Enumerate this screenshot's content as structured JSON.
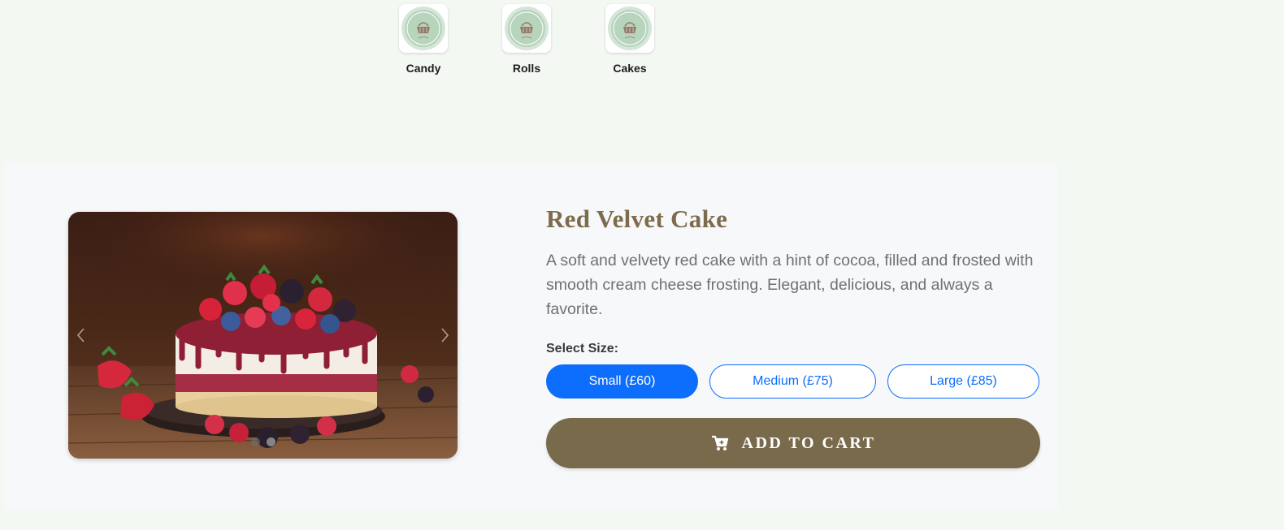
{
  "categories": [
    {
      "label": "Candy",
      "icon": "basket-icon"
    },
    {
      "label": "Rolls",
      "icon": "basket-icon"
    },
    {
      "label": "Cakes",
      "icon": "basket-icon"
    }
  ],
  "product": {
    "title": "Red Velvet Cake",
    "description": "A soft and velvety red cake with a hint of cocoa, filled and frosted with smooth cream cheese frosting. Elegant, delicious, and always a favorite.",
    "size_label": "Select Size:",
    "sizes": [
      {
        "label": "Small (£60)",
        "selected": true
      },
      {
        "label": "Medium (£75)",
        "selected": false
      },
      {
        "label": "Large (£85)",
        "selected": false
      }
    ],
    "add_to_cart": "ADD TO CART"
  },
  "carousel": {
    "slide_count": 2,
    "active_slide": 2
  },
  "colors": {
    "page_bg": "#f3f8f2",
    "panel_bg": "#f6f8f9",
    "accent_brown": "#7a6a4c",
    "title_brown": "#7d6b4c",
    "primary_blue": "#0d6efd"
  }
}
